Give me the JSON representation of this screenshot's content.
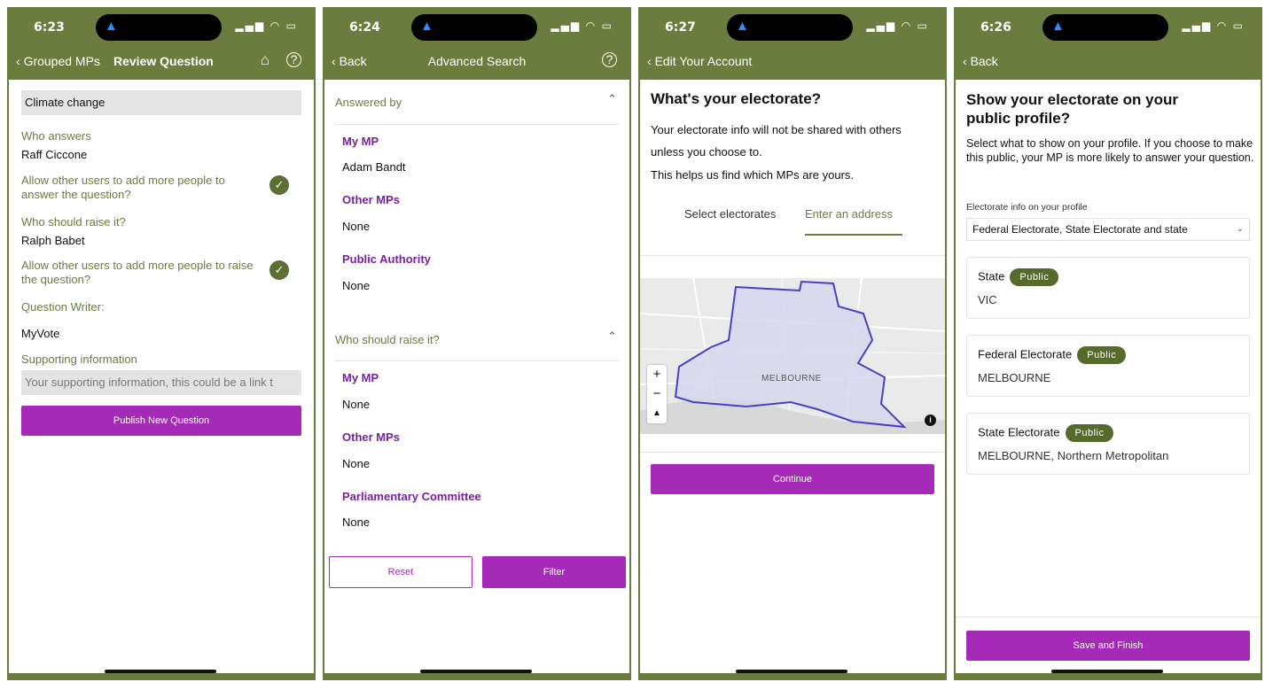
{
  "screens": [
    {
      "time": "6:23",
      "nav": {
        "back": "Grouped MPs",
        "title": "Review Question"
      },
      "topic": "Climate change",
      "who_answers_label": "Who answers",
      "who_answers_value": "Raff Ciccone",
      "allow_answer_label": "Allow other users to add more people to answer the question?",
      "who_raise_label": "Who should raise it?",
      "who_raise_value": "Ralph Babet",
      "allow_raise_label": "Allow other users to add more people to raise the question?",
      "writer_label": "Question Writer:",
      "writer_value": "MyVote",
      "supporting_label": "Supporting information",
      "supporting_placeholder": "Your supporting information, this could be a link t",
      "publish_button": "Publish New Question"
    },
    {
      "time": "6:24",
      "nav": {
        "back": "Back",
        "title": "Advanced Search"
      },
      "section1_title": "Answered by",
      "section1_items": [
        {
          "label": "My MP",
          "value": "Adam Bandt"
        },
        {
          "label": "Other MPs",
          "value": "None"
        },
        {
          "label": "Public Authority",
          "value": "None"
        }
      ],
      "section2_title": "Who should raise it?",
      "section2_items": [
        {
          "label": "My MP",
          "value": "None"
        },
        {
          "label": "Other MPs",
          "value": "None"
        },
        {
          "label": "Parliamentary Committee",
          "value": "None"
        }
      ],
      "reset_button": "Reset",
      "filter_button": "Filter"
    },
    {
      "time": "6:27",
      "nav": {
        "back": "Edit Your Account"
      },
      "heading": "What's your electorate?",
      "para1": "Your electorate info will not be shared with others unless you choose to.",
      "para2": "This helps us find which MPs are yours.",
      "tab1": "Select electorates",
      "tab2": "Enter an address",
      "map_label": "MELBOURNE",
      "continue_button": "Continue"
    },
    {
      "time": "6:26",
      "nav": {
        "back": "Back"
      },
      "heading": "Show your electorate on your public profile?",
      "para": "Select what to show on your profile. If you choose to make this public, your MP is more likely to answer your question.",
      "select_label": "Electorate info on your profile",
      "select_value": "Federal Electorate, State Electorate and state",
      "cards": [
        {
          "title": "State",
          "badge": "Public",
          "value": "VIC"
        },
        {
          "title": "Federal Electorate",
          "badge": "Public",
          "value": "MELBOURNE"
        },
        {
          "title": "State Electorate",
          "badge": "Public",
          "value": "MELBOURNE, Northern Metropolitan"
        }
      ],
      "save_button": "Save and Finish"
    }
  ],
  "colors": {
    "header": "#6b7d3e",
    "accent": "#a52ab8",
    "purple_text": "#7a1fa2",
    "badge": "#566a2c"
  }
}
